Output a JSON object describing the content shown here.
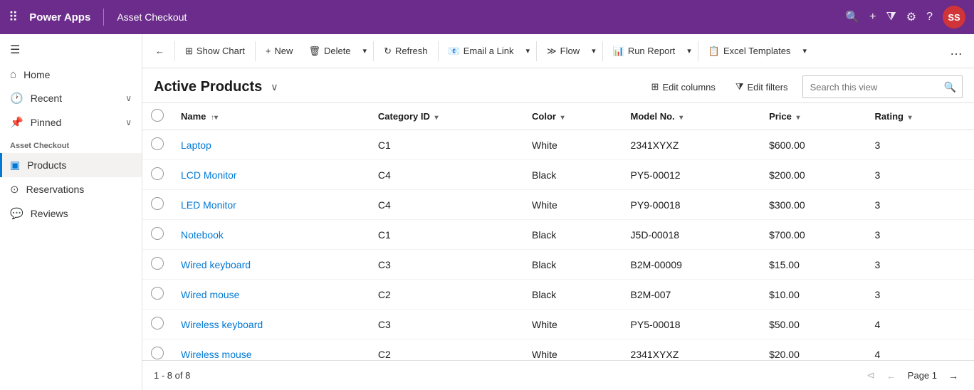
{
  "topNav": {
    "brand": "Power Apps",
    "appName": "Asset Checkout",
    "avatar": "SS",
    "avatarColor": "#d13438"
  },
  "sidebar": {
    "toggleIcon": "☰",
    "items": [
      {
        "id": "home",
        "label": "Home",
        "icon": "⌂",
        "hasChevron": false
      },
      {
        "id": "recent",
        "label": "Recent",
        "icon": "🕐",
        "hasChevron": true
      },
      {
        "id": "pinned",
        "label": "Pinned",
        "icon": "📌",
        "hasChevron": true
      }
    ],
    "sectionTitle": "Asset Checkout",
    "navItems": [
      {
        "id": "products",
        "label": "Products",
        "icon": "▣",
        "active": true
      },
      {
        "id": "reservations",
        "label": "Reservations",
        "icon": "⊙",
        "active": false
      },
      {
        "id": "reviews",
        "label": "Reviews",
        "icon": "💬",
        "active": false
      }
    ]
  },
  "commandBar": {
    "backIcon": "←",
    "showChart": "Show Chart",
    "new": "New",
    "delete": "Delete",
    "refresh": "Refresh",
    "emailLink": "Email a Link",
    "flow": "Flow",
    "runReport": "Run Report",
    "excelTemplates": "Excel Templates"
  },
  "viewHeader": {
    "title": "Active Products",
    "editColumnsLabel": "Edit columns",
    "editFiltersLabel": "Edit filters",
    "searchPlaceholder": "Search this view"
  },
  "table": {
    "columns": [
      {
        "id": "name",
        "label": "Name",
        "sortIcon": "↑▾"
      },
      {
        "id": "categoryId",
        "label": "Category ID",
        "sortIcon": "▾"
      },
      {
        "id": "color",
        "label": "Color",
        "sortIcon": "▾"
      },
      {
        "id": "modelNo",
        "label": "Model No.",
        "sortIcon": "▾"
      },
      {
        "id": "price",
        "label": "Price",
        "sortIcon": "▾"
      },
      {
        "id": "rating",
        "label": "Rating",
        "sortIcon": "▾"
      }
    ],
    "rows": [
      {
        "name": "Laptop",
        "categoryId": "C1",
        "color": "White",
        "modelNo": "2341XYXZ",
        "price": "$600.00",
        "rating": "3"
      },
      {
        "name": "LCD Monitor",
        "categoryId": "C4",
        "color": "Black",
        "modelNo": "PY5-00012",
        "price": "$200.00",
        "rating": "3"
      },
      {
        "name": "LED Monitor",
        "categoryId": "C4",
        "color": "White",
        "modelNo": "PY9-00018",
        "price": "$300.00",
        "rating": "3"
      },
      {
        "name": "Notebook",
        "categoryId": "C1",
        "color": "Black",
        "modelNo": "J5D-00018",
        "price": "$700.00",
        "rating": "3"
      },
      {
        "name": "Wired keyboard",
        "categoryId": "C3",
        "color": "Black",
        "modelNo": "B2M-00009",
        "price": "$15.00",
        "rating": "3"
      },
      {
        "name": "Wired mouse",
        "categoryId": "C2",
        "color": "Black",
        "modelNo": "B2M-007",
        "price": "$10.00",
        "rating": "3"
      },
      {
        "name": "Wireless keyboard",
        "categoryId": "C3",
        "color": "White",
        "modelNo": "PY5-00018",
        "price": "$50.00",
        "rating": "4"
      },
      {
        "name": "Wireless mouse",
        "categoryId": "C2",
        "color": "White",
        "modelNo": "2341XYXZ",
        "price": "$20.00",
        "rating": "4"
      }
    ]
  },
  "footer": {
    "range": "1 - 8 of 8",
    "pageLabel": "Page 1"
  }
}
